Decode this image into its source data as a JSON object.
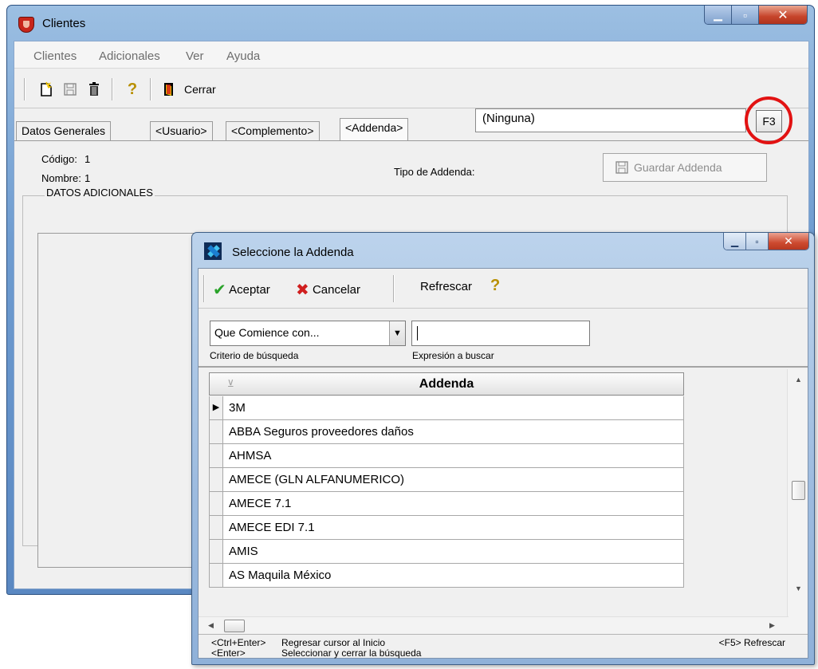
{
  "main_window": {
    "title": "Clientes",
    "menu": [
      "Clientes",
      "Adicionales",
      "Ver",
      "Ayuda"
    ],
    "toolbar": {
      "close_label": "Cerrar"
    },
    "tabs": [
      "Datos Generales",
      "<Usuario>",
      "<Complemento>",
      "<Addenda>"
    ],
    "codigo_label": "Código:",
    "codigo_value": "1",
    "nombre_label": "Nombre:",
    "nombre_value": "1",
    "tipo_label": "Tipo de Addenda:",
    "tipo_value": "(Ninguna)",
    "f3_label": "F3",
    "guardar_label": "Guardar Addenda",
    "datos_adicionales": "DATOS ADICIONALES"
  },
  "dialog": {
    "title": "Seleccione la Addenda",
    "toolbar": {
      "aceptar": "Aceptar",
      "cancelar": "Cancelar",
      "refrescar": "Refrescar"
    },
    "criterio_value": "Que Comience con...",
    "criterio_label": "Criterio de búsqueda",
    "expresion_label": "Expresión a buscar",
    "grid_header": "Addenda",
    "rows": [
      "3M",
      "ABBA Seguros proveedores daños",
      "AHMSA",
      "AMECE (GLN ALFANUMERICO)",
      "AMECE 7.1",
      "AMECE EDI 7.1",
      "AMIS",
      "AS Maquila México"
    ],
    "status": {
      "line1_key": "<Ctrl+Enter>",
      "line1_text": "Regresar cursor al Inicio",
      "line2_key": "<Enter>",
      "line2_text": "Seleccionar y cerrar la búsqueda",
      "refresh": "<F5> Refrescar"
    }
  },
  "colors": {
    "highlight_circle": "#e21212",
    "aceptar_check": "#2aa32a",
    "cancelar_x": "#d01f1f"
  }
}
